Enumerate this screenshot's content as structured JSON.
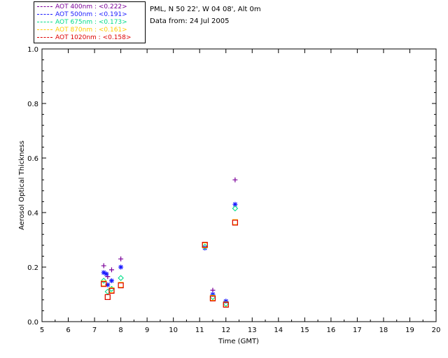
{
  "legend": {
    "items": [
      {
        "label": "AOT  400nm : <0.222>",
        "color": "#7b0099"
      },
      {
        "label": "AOT  500nm : <0.191>",
        "color": "#1a1aff"
      },
      {
        "label": "AOT  675nm : <0.173>",
        "color": "#00dd88"
      },
      {
        "label": "AOT  870nm : <0.161>",
        "color": "#ffcc00"
      },
      {
        "label": "AOT 1020nm : <0.158>",
        "color": "#dd0000"
      }
    ]
  },
  "info": {
    "location": "PML, N 50 22', W 04 08', Alt 0m",
    "date": "Data from: 24 Jul 2005"
  },
  "chart_data": {
    "type": "scatter",
    "xlabel": "Time (GMT)",
    "ylabel": "Aerosol Optical Thickness",
    "xlim": [
      5,
      20
    ],
    "ylim": [
      0.0,
      1.0
    ],
    "xticks": [
      "5",
      "6",
      "7",
      "8",
      "9",
      "10",
      "11",
      "12",
      "13",
      "14",
      "15",
      "16",
      "17",
      "18",
      "19",
      "20"
    ],
    "yticks": [
      "0.0",
      "0.2",
      "0.4",
      "0.6",
      "0.8",
      "1.0"
    ],
    "grid": false,
    "legend_position": "top-left outside",
    "series": [
      {
        "name": "AOT  400nm : <0.222>",
        "marker": "plus",
        "color": "#7b0099",
        "x": [
          7.35,
          7.5,
          7.65,
          8.0,
          11.5,
          12.35
        ],
        "y": [
          0.205,
          0.165,
          0.19,
          0.23,
          0.115,
          0.52
        ]
      },
      {
        "name": "AOT  500nm : <0.191>",
        "marker": "asterisk",
        "color": "#1a1aff",
        "x": [
          7.35,
          7.45,
          7.5,
          7.65,
          8.0,
          11.2,
          11.5,
          12.0,
          12.35
        ],
        "y": [
          0.18,
          0.175,
          0.135,
          0.15,
          0.2,
          0.27,
          0.1,
          0.075,
          0.43
        ]
      },
      {
        "name": "AOT  675nm : <0.173>",
        "marker": "diamond",
        "color": "#00dd88",
        "x": [
          7.35,
          7.5,
          7.65,
          8.0,
          11.2,
          11.5,
          12.0,
          12.35
        ],
        "y": [
          0.15,
          0.11,
          0.12,
          0.16,
          0.275,
          0.09,
          0.065,
          0.415
        ]
      },
      {
        "name": "AOT  870nm : <0.161>",
        "marker": "square",
        "color": "#ffcc00",
        "x": [
          7.35,
          7.5,
          7.65,
          8.0,
          11.2,
          11.5,
          12.0,
          12.35
        ],
        "y": [
          0.14,
          0.09,
          0.115,
          0.135,
          0.28,
          0.087,
          0.063,
          0.365
        ]
      },
      {
        "name": "AOT 1020nm : <0.158>",
        "marker": "square",
        "color": "#dd0000",
        "x": [
          7.35,
          7.5,
          7.65,
          8.0,
          11.2,
          11.5,
          12.0,
          12.35
        ],
        "y": [
          0.138,
          0.09,
          0.113,
          0.133,
          0.282,
          0.085,
          0.062,
          0.363
        ]
      }
    ]
  }
}
